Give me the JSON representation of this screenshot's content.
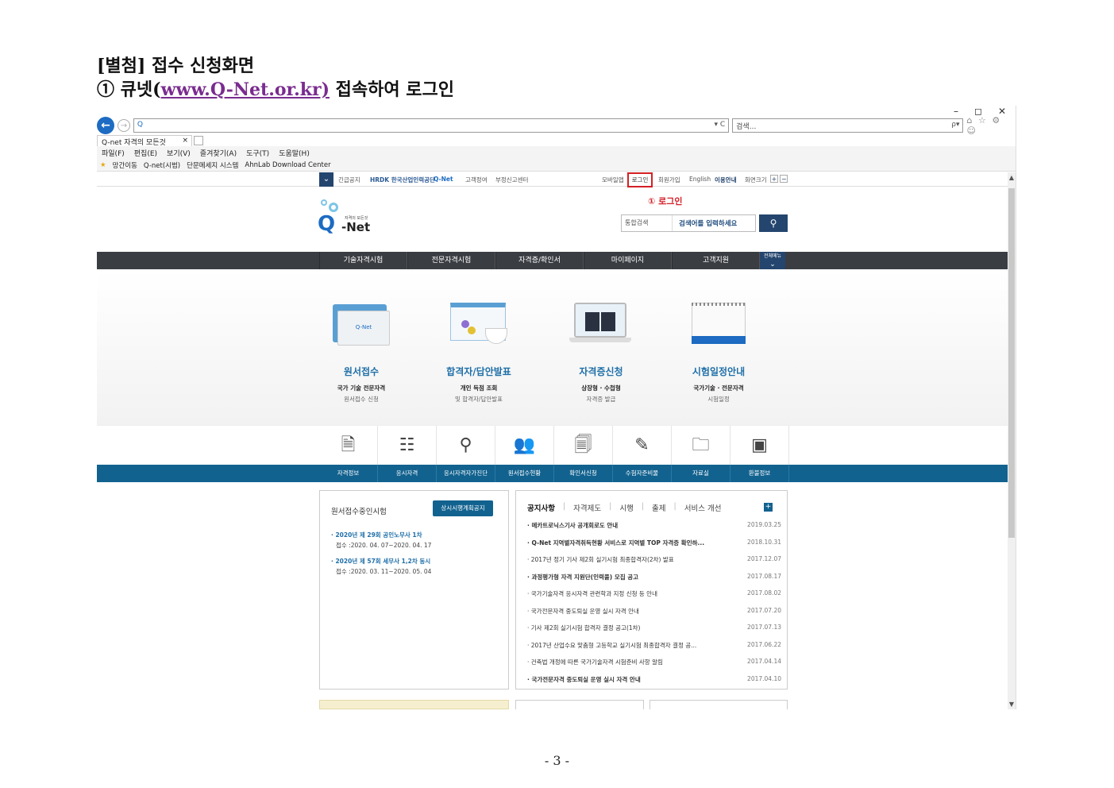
{
  "doc": {
    "line1": "[별첨]  접수  신청화면",
    "line2_prefix": "①  큐넷(",
    "line2_link": "www.Q-Net.or.kr)",
    "line2_suffix": "  접속하여  로그인",
    "page_number": "- 3 -"
  },
  "browser": {
    "window_controls": [
      "–",
      "◻",
      "✕"
    ],
    "back_icon": "back-arrow-icon",
    "address_value": "Q",
    "address_right": "▾ C",
    "search_placeholder": "검색...",
    "search_right": "ρ▾",
    "right_icons": "⌂ ☆ ⚙ ☺",
    "tab_label": "Q-net 자격의 모든것",
    "tab_close": "×",
    "menu": [
      "파일(F)",
      "편집(E)",
      "보기(V)",
      "즐겨찾기(A)",
      "도구(T)",
      "도움말(H)"
    ],
    "favorites": [
      "망간이동",
      "Q-net(시범)",
      "단문메세지 시스템",
      "AhnLab Download Center"
    ]
  },
  "site": {
    "topbar": {
      "left": [
        "긴급공지",
        "HRDK 한국산업인력공단",
        "Q-Net",
        "고객정여",
        "부정신고센터"
      ],
      "right_mobile": "모바일앱",
      "login": "로그인",
      "join": "회원가입",
      "english": "English",
      "guide": "이용안내",
      "zoom": "화면크기",
      "zoom_plus": "+",
      "zoom_minus": "−"
    },
    "annotation": "① 로그인",
    "logo": {
      "q": "Q",
      "net": "-Net",
      "tagline": "자격의 모든것"
    },
    "search": {
      "scope": "통합검색",
      "placeholder": "검색어를 입력하세요"
    },
    "gnb": [
      "기술자격시험",
      "전문자격시험",
      "자격증/확인서",
      "마이페이지",
      "고객지원"
    ],
    "gnb_all": "전체메뉴",
    "quick": [
      {
        "title": "원서접수",
        "s1": "국가 기술 전문자격",
        "s2": "원서접수 신청"
      },
      {
        "title": "합격자/답안발표",
        "s1": "개인 득점 조회",
        "s2": "및 합격자/답안발표"
      },
      {
        "title": "자격증신청",
        "s1": "상장형 · 수첩형",
        "s2": "자격증 발급"
      },
      {
        "title": "시험일정안내",
        "s1": "국가기술 · 전문자격",
        "s2": "시험일정"
      }
    ],
    "icon_menu": [
      "자격정보",
      "응시자격",
      "응시자격자가진단",
      "원서접수현황",
      "확인서신청",
      "수험자준비물",
      "자료실",
      "환불정보"
    ],
    "exam": {
      "heading": "원서접수중인시험",
      "button": "상시시행계획공지",
      "items": [
        {
          "title": "· 2020년 제 29회 공인노무사 1차",
          "date": "접수 :2020. 04. 07~2020. 04. 17"
        },
        {
          "title": "· 2020년 제 57회 세무사 1,2차 동시",
          "date": "접수 :2020. 03. 11~2020. 05. 04"
        }
      ]
    },
    "notice": {
      "tabs": [
        "공지사항",
        "자격제도",
        "시행",
        "출제",
        "서비스 개선"
      ],
      "more": "+",
      "rows": [
        {
          "title": "· 메카트로닉스기사 공개회로도 안내",
          "date": "2019.03.25"
        },
        {
          "title": "· Q-Net 지역별자격취득현황 서비스로 지역별 TOP 자격증 확인하...",
          "date": "2018.10.31"
        },
        {
          "title": "· 2017년 정기 기사 제2회 실기시험 최종합격자(2차) 발표",
          "date": "2017.12.07"
        },
        {
          "title": "· 과정평가형 자격 지원단(인력풀) 모집 공고",
          "date": "2017.08.17"
        },
        {
          "title": "· 국가기술자격 응시자격 관련학과 지정 신청 등 안내",
          "date": "2017.08.02"
        },
        {
          "title": "· 국가전문자격 중도퇴실 운영 실시 자격 안내",
          "date": "2017.07.20"
        },
        {
          "title": "· 기사 제2회 실기시험 합격자 결정 공고(1차)",
          "date": "2017.07.13"
        },
        {
          "title": "· 2017년 산업수요 맞춤형 고등학교 실기시험 최종합격자 결정 공...",
          "date": "2017.06.22"
        },
        {
          "title": "· 건축법 개정에 따른 국가기술자격 시험준비 사항 알림",
          "date": "2017.04.14"
        },
        {
          "title": "· 국가전문자격 중도퇴실 운영 실시 자격 안내",
          "date": "2017.04.10"
        }
      ]
    }
  }
}
